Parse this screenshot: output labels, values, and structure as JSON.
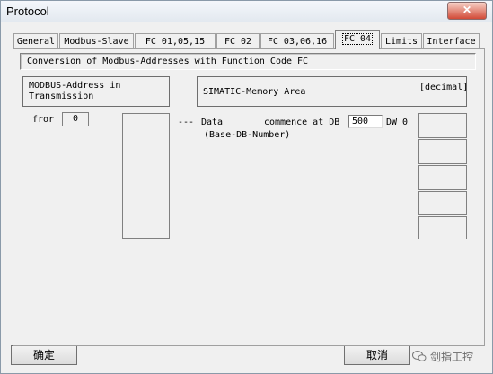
{
  "window": {
    "title": "Protocol"
  },
  "tabs": [
    "General",
    "Modbus-Slave",
    "FC 01,05,15",
    "FC 02",
    "FC 03,06,16",
    "FC 04",
    "Limits",
    "Interface"
  ],
  "panel": {
    "heading": "Conversion of  Modbus-Addresses  with  Function Code  FC",
    "modbus_label_line1": "MODBUS-Address in",
    "modbus_label_line2": "Transmission",
    "simatic_label": "SIMATIC-Memory Area",
    "decimal_label": "[decimal]",
    "from_label": "fror",
    "from_value": "0",
    "dash_text": "---",
    "data_label": "Data",
    "commence_label": "commence at DB",
    "db_value": "500",
    "dw_label": "DW 0",
    "base_db_label": "(Base-DB-Number)"
  },
  "buttons": {
    "ok": "确定",
    "cancel": "取消"
  },
  "watermark": {
    "text": "剑指工控"
  }
}
